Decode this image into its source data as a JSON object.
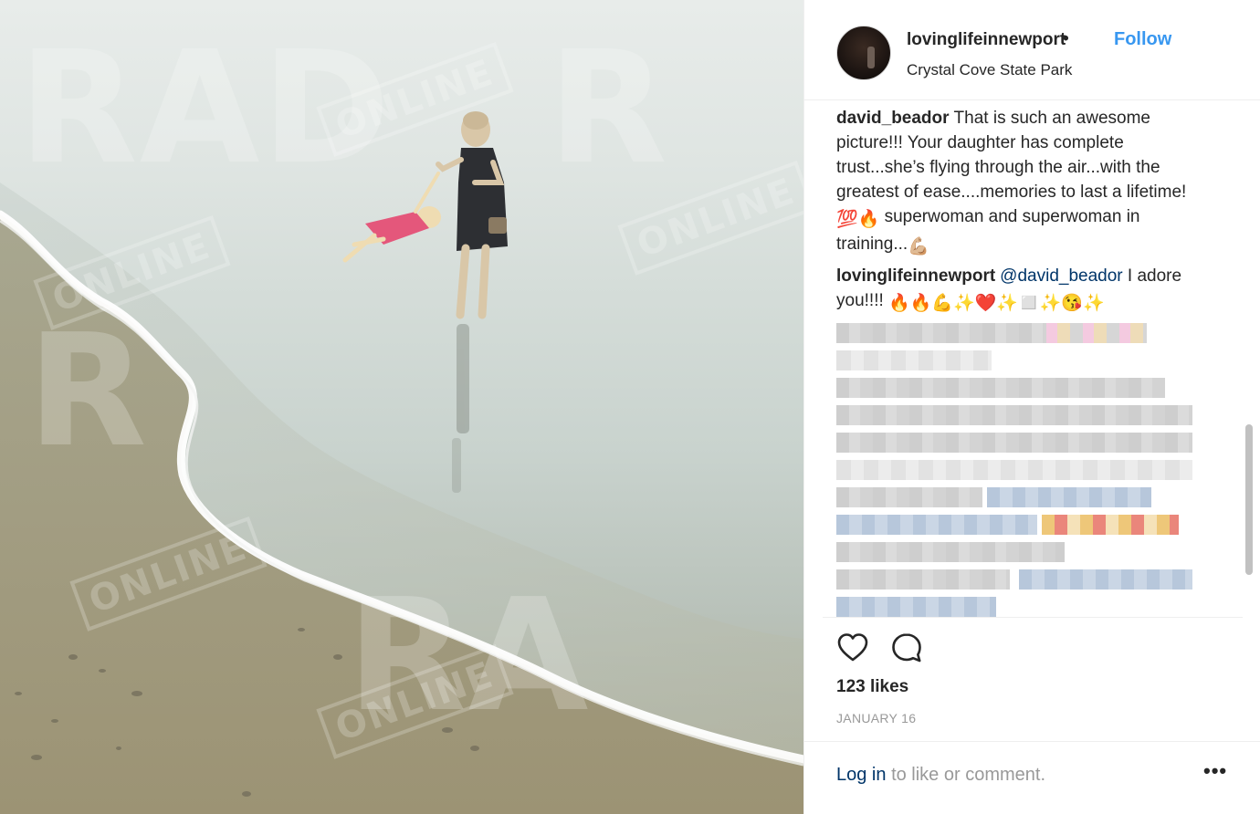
{
  "post": {
    "username": "lovinglifeinnewport",
    "separator": "•",
    "follow_label": "Follow",
    "location": "Crystal Cove State Park",
    "image_alt_watermark": "RADAR ONLINE",
    "watermark_big": "RAD",
    "watermark_small": "ONLINE"
  },
  "comments": [
    {
      "author": "david_beador",
      "text": "That is such an awesome picture!!! Your daughter has complete trust...she’s flying through the air...with the greatest of ease....memories to last a lifetime!",
      "emoji_1": "💯🔥",
      "text_2": "superwoman and superwoman in training...",
      "emoji_2": "💪🏼"
    },
    {
      "author": "lovinglifeinnewport",
      "mention": "@david_beador",
      "text": "I adore you!!!!",
      "emoji": "🔥🔥💪✨❤️✨◻️✨😘✨"
    }
  ],
  "actions": {
    "like_icon": "heart-outline-icon",
    "comment_icon": "comment-bubble-icon"
  },
  "likes_text": "123 likes",
  "date_text": "JANUARY 16",
  "login": {
    "link": "Log in",
    "rest": "to like or comment."
  },
  "more_label": "•••",
  "colors": {
    "link_blue": "#3897f0",
    "text": "#262626",
    "muted": "#999999",
    "mention": "#003569"
  }
}
